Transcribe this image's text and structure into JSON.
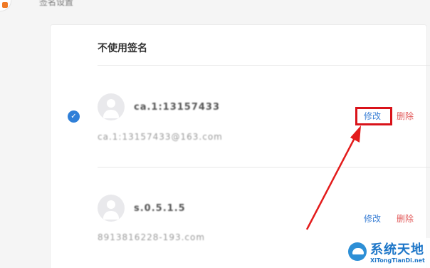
{
  "section": {
    "title": "签名设置"
  },
  "card": {
    "header": "不使用签名"
  },
  "signatures": [
    {
      "name": "ca.1:13157433",
      "detail": "ca.1:13157433@163.com",
      "selected": true,
      "edit_label": "修改",
      "delete_label": "删除"
    },
    {
      "name": "s.0.5.1.5",
      "detail": "8913816228-193.com",
      "selected": false,
      "edit_label": "修改",
      "delete_label": "删除"
    }
  ],
  "watermark": {
    "title": "系统天地",
    "url": "XiTongTianDi.net"
  },
  "colors": {
    "accent": "#2f7fd8",
    "edit": "#3a7fd5",
    "delete": "#e25a5a",
    "highlight": "#d9131a"
  },
  "icons": {
    "selected": "check-circle-icon",
    "avatar": "user-avatar-icon",
    "annotation": "red-arrow"
  }
}
